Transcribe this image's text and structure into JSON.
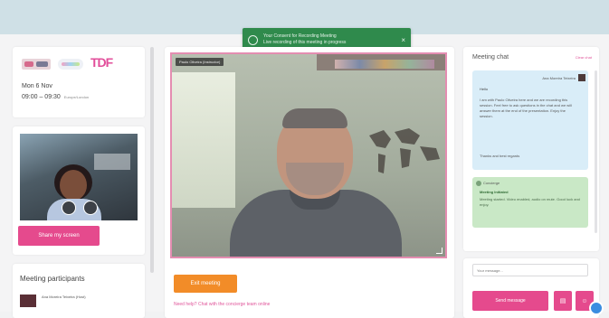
{
  "toast": {
    "line1": "Your Consent for Recording Meeting",
    "line2": "Live recording of this meeting in progress",
    "close_icon": "close-icon"
  },
  "event": {
    "logo_text": "TDF",
    "date": "Mon 6 Nov",
    "time": "09:00 – 09:30",
    "timezone": "Europe/London"
  },
  "self_view": {
    "share_label": "Share my screen"
  },
  "participants": {
    "title": "Meeting participants",
    "items": [
      {
        "name": "Ana Moreira Teixeira (Host)"
      }
    ]
  },
  "main": {
    "speaker_name": "Paulo Oliveira (Instructor)",
    "exit_label": "Exit meeting",
    "help_text": "Need help? Chat with the concierge team online"
  },
  "chat": {
    "title": "Meeting chat",
    "link": "Clear chat",
    "message1": {
      "sender": "Ana Moreira Teixeira",
      "greeting": "Hello",
      "body": "I am with Paulo Oliveira here and we are recording this session. Feel free to ask questions in the chat and we will answer them at the end of the presentation. Enjoy the session.",
      "closing": "Thanks and best regards"
    },
    "message2": {
      "sender": "Concierge",
      "title": "Meeting Initiated",
      "body": "Meeting started. Video enabled, audio on mute. Good luck and enjoy."
    }
  },
  "compose": {
    "placeholder": "Your message...",
    "send_label": "Send message"
  },
  "colors": {
    "accent": "#e54a8d",
    "exit": "#f28c28",
    "toast": "#2f8a4c"
  }
}
